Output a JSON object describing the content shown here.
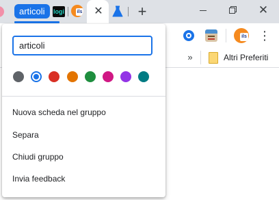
{
  "tabstrip": {
    "group_name": "articoli",
    "group_color": "#1a73e8",
    "logi_favicon_text": "logi",
    "ils_favicon_text": "ils",
    "active_tab_close_glyph": "✕",
    "new_tab_glyph": "+",
    "window_close_glyph": "✕"
  },
  "toolbar": {
    "profile_text": "ils",
    "menu_glyph": "⋮"
  },
  "bookmarks": {
    "chevron_glyph": "»",
    "folder_label": "Altri Preferiti"
  },
  "tab_group_editor": {
    "name_value": "articoli",
    "name_placeholder": "",
    "colors": [
      {
        "name": "grey",
        "hex": "#5f6368",
        "selected": false
      },
      {
        "name": "blue",
        "hex": "#1a73e8",
        "selected": true
      },
      {
        "name": "red",
        "hex": "#d93025",
        "selected": false
      },
      {
        "name": "yellow",
        "hex": "#e37400",
        "selected": false
      },
      {
        "name": "green",
        "hex": "#1e8e3e",
        "selected": false
      },
      {
        "name": "pink",
        "hex": "#d01884",
        "selected": false
      },
      {
        "name": "purple",
        "hex": "#9334e6",
        "selected": false
      },
      {
        "name": "cyan",
        "hex": "#007b83",
        "selected": false
      }
    ],
    "menu": [
      {
        "label": "Nuova scheda nel gruppo"
      },
      {
        "label": "Separa"
      },
      {
        "label": "Chiudi gruppo"
      },
      {
        "label": "Invia feedback"
      }
    ]
  }
}
